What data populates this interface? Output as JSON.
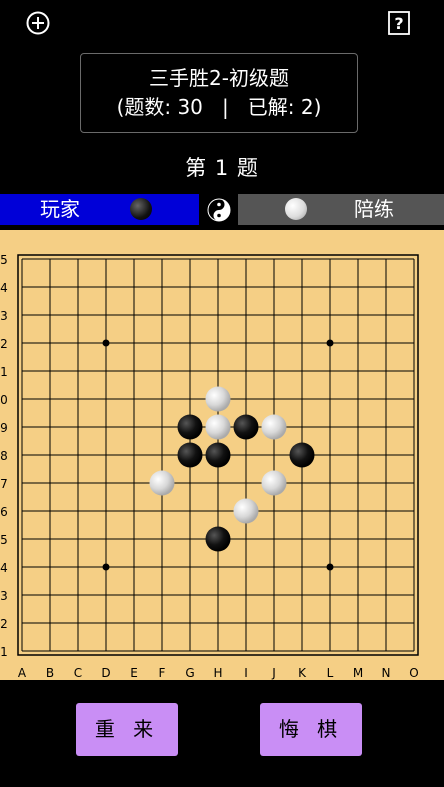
{
  "header": {
    "add_icon": "plus-circle-icon",
    "help_icon": "question-box-icon",
    "title_line1": "三手胜2-初级题",
    "title_line2": "(题数: 30   |   已解: 2)"
  },
  "question_label": "第 1 题",
  "players": {
    "player_label": "玩家",
    "player_stone": "black",
    "turn_icon": "yin-yang-icon",
    "coach_label": "陪练",
    "coach_stone": "white"
  },
  "board": {
    "size": 15,
    "col_labels": [
      "A",
      "B",
      "C",
      "D",
      "E",
      "F",
      "G",
      "H",
      "I",
      "J",
      "K",
      "L",
      "M",
      "N",
      "O"
    ],
    "row_labels": [
      "5",
      "4",
      "3",
      "2",
      "1",
      "0",
      "9",
      "8",
      "7",
      "6",
      "5",
      "4",
      "3",
      "2",
      "1"
    ],
    "star_points": [
      [
        3,
        3
      ],
      [
        11,
        3
      ],
      [
        3,
        11
      ],
      [
        11,
        11
      ]
    ],
    "stones": [
      {
        "col": 7,
        "row": 5,
        "color": "white"
      },
      {
        "col": 6,
        "row": 6,
        "color": "black"
      },
      {
        "col": 7,
        "row": 6,
        "color": "white"
      },
      {
        "col": 8,
        "row": 6,
        "color": "black"
      },
      {
        "col": 9,
        "row": 6,
        "color": "white"
      },
      {
        "col": 6,
        "row": 7,
        "color": "black"
      },
      {
        "col": 7,
        "row": 7,
        "color": "black"
      },
      {
        "col": 10,
        "row": 7,
        "color": "black"
      },
      {
        "col": 5,
        "row": 8,
        "color": "white"
      },
      {
        "col": 9,
        "row": 8,
        "color": "white"
      },
      {
        "col": 8,
        "row": 9,
        "color": "white"
      },
      {
        "col": 7,
        "row": 10,
        "color": "black"
      }
    ],
    "colors": {
      "wood": "#f5cf85",
      "line": "#000000",
      "black_stone": "#111111",
      "white_stone": "#d8d8d8"
    }
  },
  "buttons": {
    "restart_label": "重 来",
    "undo_label": "悔 棋"
  }
}
